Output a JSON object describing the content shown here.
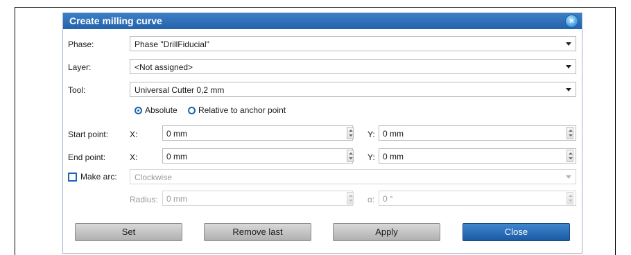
{
  "dialog": {
    "title": "Create milling curve",
    "close_glyph": "×"
  },
  "fields": {
    "phase": {
      "label": "Phase:",
      "value": "Phase \"DrillFiducial\""
    },
    "layer": {
      "label": "Layer:",
      "value": "<Not assigned>"
    },
    "tool": {
      "label": "Tool:",
      "value": "Universal Cutter 0,2 mm"
    }
  },
  "mode": {
    "options": [
      "Absolute",
      "Relative to anchor point"
    ],
    "selected": "Absolute"
  },
  "start_point": {
    "label": "Start point:",
    "x_label": "X:",
    "x_value": "0 mm",
    "y_label": "Y:",
    "y_value": "0 mm"
  },
  "end_point": {
    "label": "End point:",
    "x_label": "X:",
    "x_value": "0 mm",
    "y_label": "Y:",
    "y_value": "0 mm"
  },
  "arc": {
    "checkbox_label": "Make arc:",
    "checked": false,
    "direction_value": "Clockwise",
    "radius_label": "Radius:",
    "radius_value": "0 mm",
    "angle_label": "α:",
    "angle_value": "0 °"
  },
  "buttons": {
    "set": "Set",
    "remove_last": "Remove last",
    "apply": "Apply",
    "close": "Close"
  },
  "colors": {
    "title_bar": "#2d6fb8",
    "accent": "#1e63b4",
    "primary_button": "#1b5aa3"
  }
}
